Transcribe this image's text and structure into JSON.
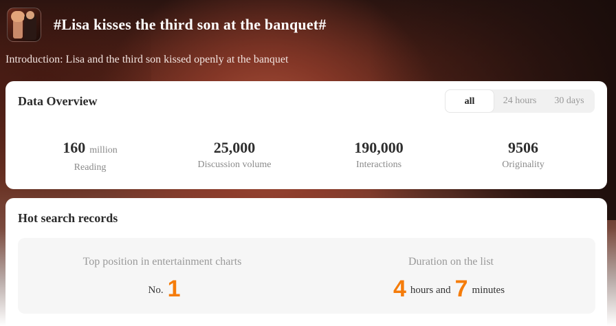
{
  "topic": {
    "title": "#Lisa kisses the third son at the banquet#",
    "introduction": "Introduction: Lisa and the third son kissed openly at the banquet",
    "avatar_icon": "topic-thumbnail-image"
  },
  "overview": {
    "title": "Data Overview",
    "tabs": [
      {
        "label": "all",
        "active": true
      },
      {
        "label": "24 hours",
        "active": false
      },
      {
        "label": "30 days",
        "active": false
      }
    ],
    "stats": [
      {
        "value": "160",
        "unit": "million",
        "label": "Reading"
      },
      {
        "value": "25,000",
        "unit": "",
        "label": "Discussion volume"
      },
      {
        "value": "190,000",
        "unit": "",
        "label": "Interactions"
      },
      {
        "value": "9506",
        "unit": "",
        "label": "Originality"
      }
    ]
  },
  "hot_search": {
    "title": "Hot search records",
    "top_position": {
      "label": "Top position in entertainment charts",
      "prefix": "No.",
      "rank": "1"
    },
    "duration": {
      "label": "Duration on the list",
      "hours": "4",
      "hours_text": "hours and",
      "minutes": "7",
      "minutes_text": "minutes"
    }
  },
  "colors": {
    "accent": "#f57c0a",
    "card_bg": "#ffffff",
    "panel_bg": "#f6f6f6"
  }
}
